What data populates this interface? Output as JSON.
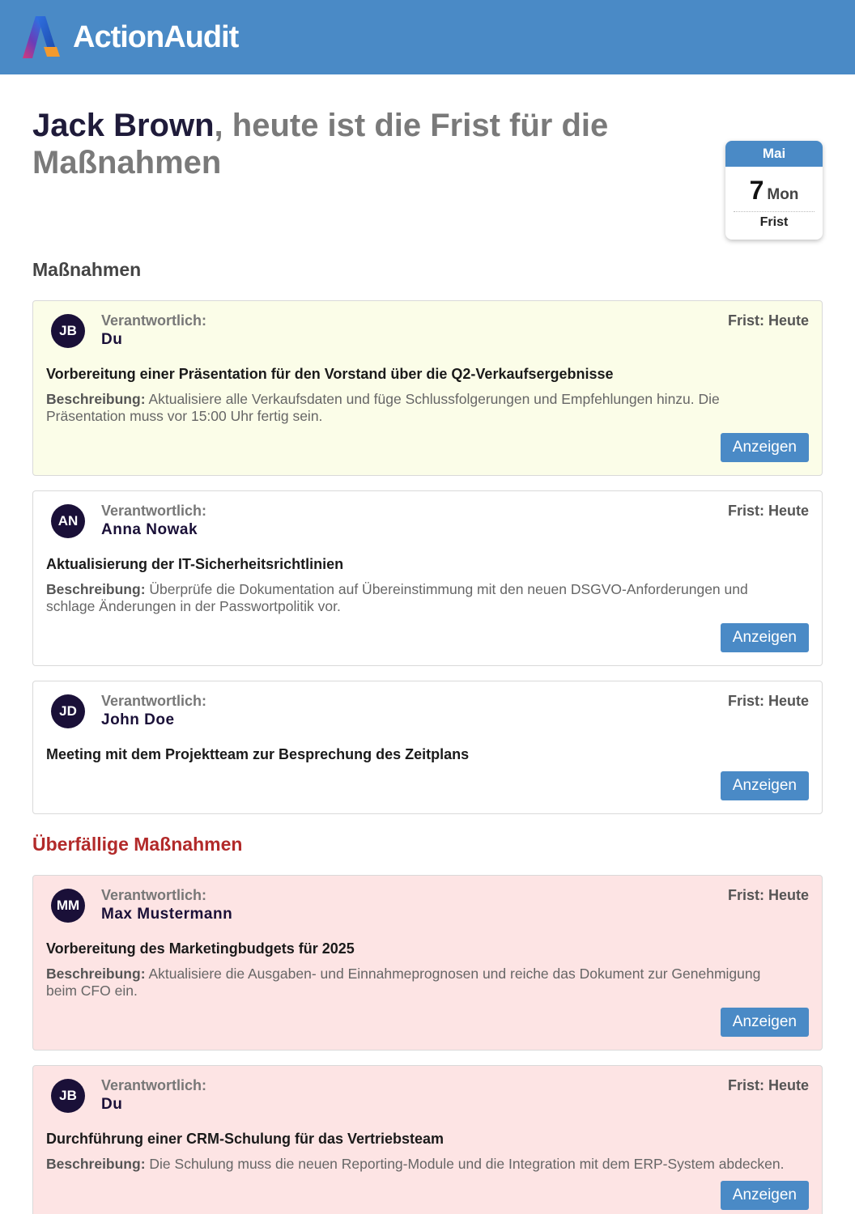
{
  "app": {
    "name": "ActionAudit",
    "brand_color": "#4a8ac6",
    "logo_icon": "action-audit-logo"
  },
  "headline": {
    "name": "Jack Brown",
    "rest": ", heute ist die Frist für die Maßnahmen"
  },
  "calendar": {
    "month": "Mai",
    "day": "7",
    "weekday": "Mon",
    "label": "Frist"
  },
  "sections": {
    "current_title": "Maßnahmen",
    "overdue_title": "Überfällige Maßnahmen"
  },
  "labels": {
    "responsible": "Verantwortlich:",
    "description": "Beschreibung:",
    "view_button": "Anzeigen"
  },
  "tasks": [
    {
      "initials": "JB",
      "owner": "Du",
      "deadline": "Frist: Heute",
      "title": "Vorbereitung einer Präsentation für den Vorstand über die Q2-Verkaufsergebnisse",
      "description": "Aktualisiere alle Verkaufsdaten und füge Schlussfolgerungen und Empfehlungen hinzu. Die Präsentation muss vor 15:00 Uhr fertig sein."
    },
    {
      "initials": "AN",
      "owner": "Anna Nowak",
      "deadline": "Frist: Heute",
      "title": "Aktualisierung der IT-Sicherheitsrichtlinien",
      "description": "Überprüfe die Dokumentation auf Übereinstimmung mit den neuen DSGVO-Anforderungen und schlage Änderungen in der Passwortpolitik vor."
    },
    {
      "initials": "JD",
      "owner": "John Doe",
      "deadline": "Frist: Heute",
      "title": "Meeting mit dem Projektteam zur Besprechung des Zeitplans"
    }
  ],
  "overdue_tasks": [
    {
      "initials": "MM",
      "owner": "Max Mustermann",
      "deadline": "Frist: Heute",
      "title": "Vorbereitung des Marketingbudgets für 2025",
      "description": "Aktualisiere die Ausgaben- und Einnahmeprognosen und reiche das Dokument zur Genehmigung beim CFO ein."
    },
    {
      "initials": "JB",
      "owner": "Du",
      "deadline": "Frist: Heute",
      "title": "Durchführung einer CRM-Schulung für das Vertriebsteam",
      "description": "Die Schulung muss die neuen Reporting-Module und die Integration mit dem ERP-System abdecken."
    }
  ]
}
